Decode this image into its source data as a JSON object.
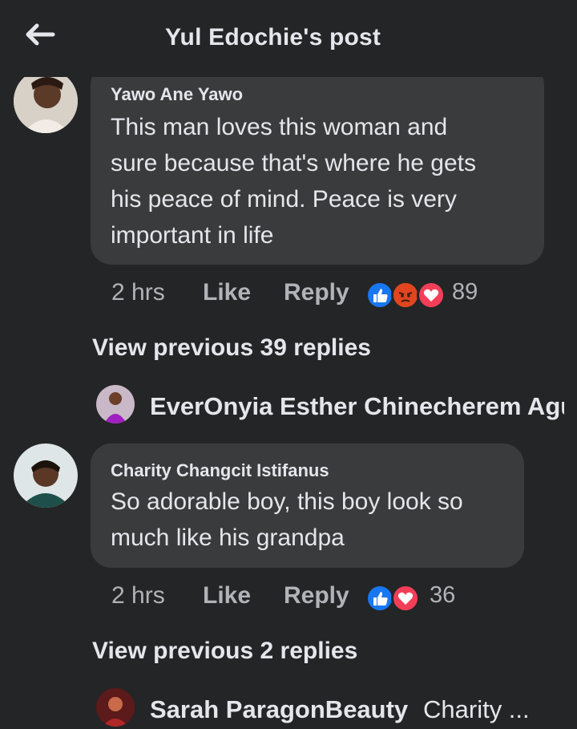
{
  "header": {
    "title": "Yul Edochie's post",
    "back_icon": "arrow-left-icon"
  },
  "comments": [
    {
      "author": "Yawo Ane Yawo",
      "lines": [
        "This man loves this woman and",
        "sure because that's where he gets",
        "his peace of mind. Peace is very",
        "important in life"
      ],
      "time": "2 hrs",
      "like": "Like",
      "reply": "Reply",
      "reactions": [
        "like",
        "angry",
        "love"
      ],
      "reaction_count": "89",
      "view_previous": "View previous 39 replies",
      "reply_preview": {
        "name": "EverOnyia Esther Chinecherem Agu",
        "text": ""
      }
    },
    {
      "author": "Charity Changcit Istifanus",
      "lines": [
        "So adorable boy, this boy look so",
        "much like his grandpa"
      ],
      "time": "2 hrs",
      "like": "Like",
      "reply": "Reply",
      "reactions": [
        "like",
        "love"
      ],
      "reaction_count": "36",
      "view_previous": "View previous 2 replies",
      "reply_preview": {
        "name": "Sarah ParagonBeauty",
        "text": "Charity ..."
      }
    }
  ],
  "colors": {
    "background": "#242526",
    "bubble": "#3a3b3c",
    "like_blue": "#1877f2",
    "love_red": "#f33e58",
    "angry_orange": "#e9710f"
  }
}
